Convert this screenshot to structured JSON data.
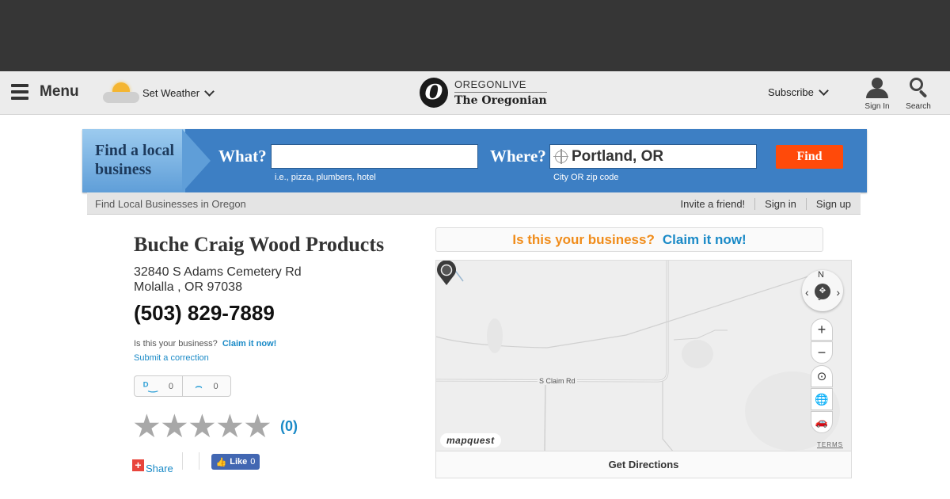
{
  "header": {
    "menu_label": "Menu",
    "weather_label": "Set Weather",
    "logo_top": "OREGONLIVE",
    "logo_bottom": "The Oregonian",
    "logo_letter": "O",
    "subscribe_label": "Subscribe",
    "signin_label": "Sign In",
    "search_label": "Search"
  },
  "search": {
    "flag_text": "Find a local business",
    "what_label": "What?",
    "what_value": "",
    "what_hint": "i.e., pizza, plumbers, hotel",
    "where_label": "Where?",
    "where_value": "Portland, OR",
    "where_hint": "City OR zip code",
    "find_label": "Find"
  },
  "subbar": {
    "left_text": "Find Local Businesses in Oregon",
    "links": [
      "Invite a friend!",
      "Sign in",
      "Sign up"
    ]
  },
  "business": {
    "name": "Buche Craig Wood Products",
    "address_line1": "32840 S Adams Cemetery Rd",
    "address_line2": "Molalla , OR 97038",
    "phone": "(503) 829-7889",
    "claim_question": "Is this your business?",
    "claim_link": "Claim it now!",
    "submit_correction": "Submit a correction",
    "thumbs_up_count": "0",
    "thumbs_down_count": "0",
    "rating_stars_filled": 0,
    "rating_stars_total": 5,
    "rating_count": "(0)",
    "share_label": "Share",
    "like_label": "Like",
    "like_count": "0"
  },
  "claim_box": {
    "question": "Is this your business?",
    "link": "Claim it now!"
  },
  "map": {
    "compass_n": "N",
    "road_label": "S Claim Rd",
    "logo": "mapquest",
    "terms": "TERMS",
    "directions_label": "Get Directions"
  },
  "colors": {
    "banner_blue": "#3d7fc4",
    "find_orange": "#ff4a0a",
    "link_blue": "#1a8ac7",
    "claim_orange": "#f08c1a",
    "facebook_blue": "#4267b2"
  }
}
